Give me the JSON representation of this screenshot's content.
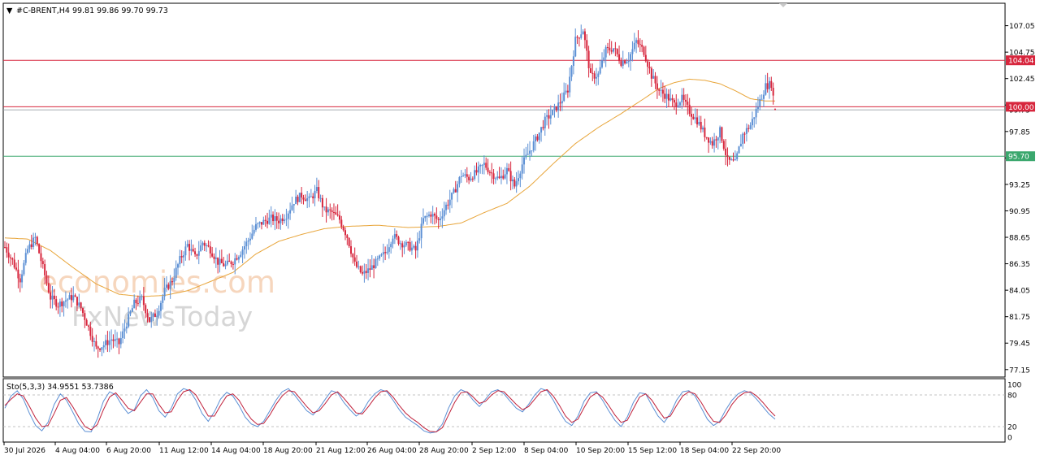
{
  "header": {
    "symbol_line": "#C-BRENT,H4  99.81 99.86 99.70 99.73"
  },
  "watermark": {
    "brand_line1": "economies.com",
    "brand_line2": "FxNewsToday"
  },
  "indicator": {
    "label": "Sto(5,3,3) 34.9551 53.7386",
    "levels": [
      "100",
      "80",
      "20",
      "0"
    ]
  },
  "colors": {
    "bull": "#5b8fd4",
    "bear": "#d7263d",
    "ma": "#e8a53a",
    "resistance": "#d7263d",
    "support": "#3aa76d",
    "stoch_main": "#5b8fd4",
    "stoch_signal": "#c0203a",
    "grid": "#000000"
  },
  "chart_data": [
    {
      "type": "candlestick",
      "symbol": "#C-BRENT",
      "timeframe": "H4",
      "last_ohlc": {
        "open": 99.81,
        "high": 99.86,
        "low": 99.7,
        "close": 99.73
      },
      "ylim": [
        76.5,
        109.0
      ],
      "y_ticks": [
        "107.05",
        "104.75",
        "102.45",
        "100.15",
        "97.85",
        "95.55",
        "93.25",
        "90.95",
        "88.65",
        "86.35",
        "84.05",
        "81.75",
        "79.45",
        "77.15"
      ],
      "x_ticks": [
        "30 Jul 2026",
        "4 Aug 04:00",
        "6 Aug 20:00",
        "11 Aug 12:00",
        "14 Aug 04:00",
        "18 Aug 20:00",
        "21 Aug 12:00",
        "26 Aug 04:00",
        "28 Aug 20:00",
        "2 Sep 12:00",
        "8 Sep 04:00",
        "10 Sep 20:00",
        "15 Sep 12:00",
        "18 Sep 04:00",
        "22 Sep 20:00"
      ],
      "horizontal_levels": [
        {
          "label": "104.04",
          "value": 104.04,
          "role": "resistance"
        },
        {
          "label": "100.00",
          "value": 100.0,
          "role": "resistance"
        },
        {
          "label": "95.70",
          "value": 95.7,
          "role": "support"
        }
      ],
      "current_price_label": "99.73",
      "close_path": [
        [
          0,
          87.8
        ],
        [
          4,
          86.6
        ],
        [
          8,
          85.0
        ],
        [
          12,
          87.6
        ],
        [
          16,
          88.6
        ],
        [
          20,
          86.0
        ],
        [
          24,
          83.4
        ],
        [
          28,
          82.8
        ],
        [
          32,
          83.2
        ],
        [
          36,
          83.5
        ],
        [
          40,
          82.5
        ],
        [
          44,
          80.8
        ],
        [
          48,
          79.0
        ],
        [
          52,
          79.3
        ],
        [
          56,
          79.8
        ],
        [
          60,
          79.4
        ],
        [
          64,
          81.2
        ],
        [
          68,
          82.9
        ],
        [
          72,
          83.3
        ],
        [
          76,
          81.4
        ],
        [
          80,
          82.1
        ],
        [
          84,
          84.0
        ],
        [
          88,
          84.9
        ],
        [
          92,
          86.7
        ],
        [
          96,
          88.0
        ],
        [
          100,
          86.9
        ],
        [
          104,
          88.2
        ],
        [
          108,
          87.6
        ],
        [
          112,
          86.5
        ],
        [
          116,
          86.2
        ],
        [
          120,
          86.6
        ],
        [
          124,
          87.4
        ],
        [
          128,
          88.4
        ],
        [
          132,
          89.6
        ],
        [
          136,
          90.0
        ],
        [
          140,
          90.3
        ],
        [
          144,
          90.1
        ],
        [
          148,
          90.6
        ],
        [
          152,
          91.8
        ],
        [
          156,
          92.3
        ],
        [
          160,
          91.9
        ],
        [
          164,
          92.7
        ],
        [
          168,
          91.0
        ],
        [
          172,
          90.8
        ],
        [
          176,
          90.2
        ],
        [
          180,
          88.7
        ],
        [
          184,
          86.3
        ],
        [
          188,
          85.4
        ],
        [
          192,
          85.9
        ],
        [
          196,
          86.6
        ],
        [
          200,
          87.3
        ],
        [
          204,
          88.8
        ],
        [
          208,
          88.2
        ],
        [
          212,
          87.9
        ],
        [
          216,
          87.5
        ],
        [
          220,
          90.2
        ],
        [
          224,
          90.7
        ],
        [
          228,
          90.1
        ],
        [
          232,
          91.4
        ],
        [
          236,
          92.5
        ],
        [
          240,
          94.1
        ],
        [
          244,
          93.8
        ],
        [
          248,
          94.3
        ],
        [
          252,
          95.0
        ],
        [
          256,
          94.2
        ],
        [
          260,
          93.7
        ],
        [
          264,
          94.5
        ],
        [
          268,
          93.1
        ],
        [
          272,
          95.0
        ],
        [
          276,
          96.2
        ],
        [
          280,
          97.4
        ],
        [
          284,
          98.8
        ],
        [
          288,
          99.5
        ],
        [
          292,
          100.4
        ],
        [
          296,
          101.5
        ],
        [
          300,
          105.8
        ],
        [
          304,
          106.7
        ],
        [
          308,
          102.6
        ],
        [
          312,
          102.8
        ],
        [
          316,
          104.9
        ],
        [
          320,
          105.1
        ],
        [
          324,
          103.9
        ],
        [
          328,
          104.2
        ],
        [
          332,
          105.7
        ],
        [
          336,
          104.8
        ],
        [
          340,
          102.7
        ],
        [
          344,
          101.4
        ],
        [
          348,
          100.9
        ],
        [
          352,
          100.2
        ],
        [
          356,
          100.7
        ],
        [
          360,
          99.6
        ],
        [
          364,
          98.8
        ],
        [
          368,
          97.6
        ],
        [
          372,
          96.8
        ],
        [
          376,
          97.9
        ],
        [
          380,
          95.3
        ],
        [
          384,
          95.1
        ],
        [
          388,
          97.6
        ],
        [
          392,
          98.4
        ],
        [
          396,
          100.1
        ],
        [
          400,
          101.8
        ],
        [
          403,
          102.0
        ],
        [
          405,
          99.73
        ]
      ],
      "ma_path": [
        [
          0,
          88.6
        ],
        [
          12,
          88.5
        ],
        [
          24,
          87.5
        ],
        [
          36,
          86.0
        ],
        [
          48,
          84.6
        ],
        [
          60,
          83.7
        ],
        [
          72,
          83.5
        ],
        [
          84,
          83.6
        ],
        [
          96,
          84.0
        ],
        [
          108,
          84.8
        ],
        [
          120,
          85.6
        ],
        [
          132,
          87.2
        ],
        [
          144,
          88.3
        ],
        [
          156,
          88.9
        ],
        [
          168,
          89.4
        ],
        [
          180,
          89.6
        ],
        [
          196,
          89.7
        ],
        [
          212,
          89.5
        ],
        [
          228,
          89.6
        ],
        [
          240,
          89.9
        ],
        [
          252,
          90.8
        ],
        [
          264,
          91.6
        ],
        [
          276,
          93.1
        ],
        [
          288,
          95.0
        ],
        [
          300,
          96.8
        ],
        [
          312,
          98.2
        ],
        [
          324,
          99.4
        ],
        [
          336,
          100.7
        ],
        [
          344,
          101.6
        ],
        [
          352,
          102.1
        ],
        [
          360,
          102.4
        ],
        [
          368,
          102.3
        ],
        [
          376,
          102.0
        ],
        [
          384,
          101.4
        ],
        [
          392,
          100.7
        ],
        [
          400,
          100.5
        ],
        [
          405,
          100.5
        ]
      ]
    },
    {
      "type": "line",
      "name": "Sto(5,3,3)",
      "ylim": [
        0,
        100
      ],
      "levels": [
        20,
        80
      ],
      "series": [
        {
          "role": "main",
          "values": [
            55,
            78,
            88,
            72,
            45,
            22,
            12,
            28,
            62,
            82,
            70,
            48,
            25,
            11,
            10,
            35,
            68,
            86,
            80,
            60,
            45,
            52,
            78,
            90,
            75,
            50,
            38,
            55,
            82,
            92,
            88,
            70,
            45,
            30,
            48,
            72,
            85,
            78,
            60,
            38,
            25,
            20,
            30,
            50,
            70,
            86,
            92,
            80,
            65,
            50,
            42,
            55,
            72,
            88,
            84,
            66,
            52,
            40,
            48,
            68,
            82,
            90,
            86,
            70,
            52,
            38,
            30,
            22,
            12,
            8,
            10,
            25,
            55,
            78,
            90,
            85,
            70,
            58,
            72,
            86,
            90,
            82,
            68,
            55,
            48,
            62,
            80,
            92,
            88,
            70,
            48,
            30,
            22,
            40,
            68,
            84,
            86,
            70,
            50,
            32,
            20,
            38,
            66,
            84,
            82,
            60,
            40,
            28,
            45,
            70,
            86,
            88,
            78,
            56,
            34,
            22,
            30,
            52,
            70,
            82,
            88,
            84,
            72,
            58,
            44,
            34
          ]
        },
        {
          "role": "signal",
          "values": [
            60,
            72,
            82,
            78,
            58,
            36,
            20,
            22,
            45,
            70,
            75,
            58,
            38,
            20,
            14,
            24,
            52,
            76,
            84,
            70,
            55,
            50,
            66,
            82,
            82,
            62,
            46,
            48,
            70,
            86,
            90,
            80,
            60,
            40,
            40,
            60,
            78,
            82,
            70,
            50,
            34,
            24,
            26,
            42,
            62,
            78,
            88,
            86,
            72,
            58,
            46,
            50,
            64,
            80,
            86,
            74,
            60,
            46,
            44,
            58,
            74,
            86,
            88,
            76,
            60,
            46,
            36,
            28,
            18,
            11,
            10,
            18,
            42,
            66,
            84,
            86,
            76,
            64,
            68,
            80,
            88,
            86,
            74,
            62,
            52,
            58,
            72,
            86,
            90,
            78,
            60,
            40,
            28,
            34,
            56,
            76,
            84,
            76,
            60,
            42,
            28,
            32,
            54,
            76,
            82,
            70,
            52,
            36,
            40,
            60,
            78,
            86,
            82,
            66,
            46,
            30,
            28,
            42,
            62,
            76,
            84,
            86,
            78,
            66,
            52,
            40
          ]
        }
      ]
    }
  ]
}
